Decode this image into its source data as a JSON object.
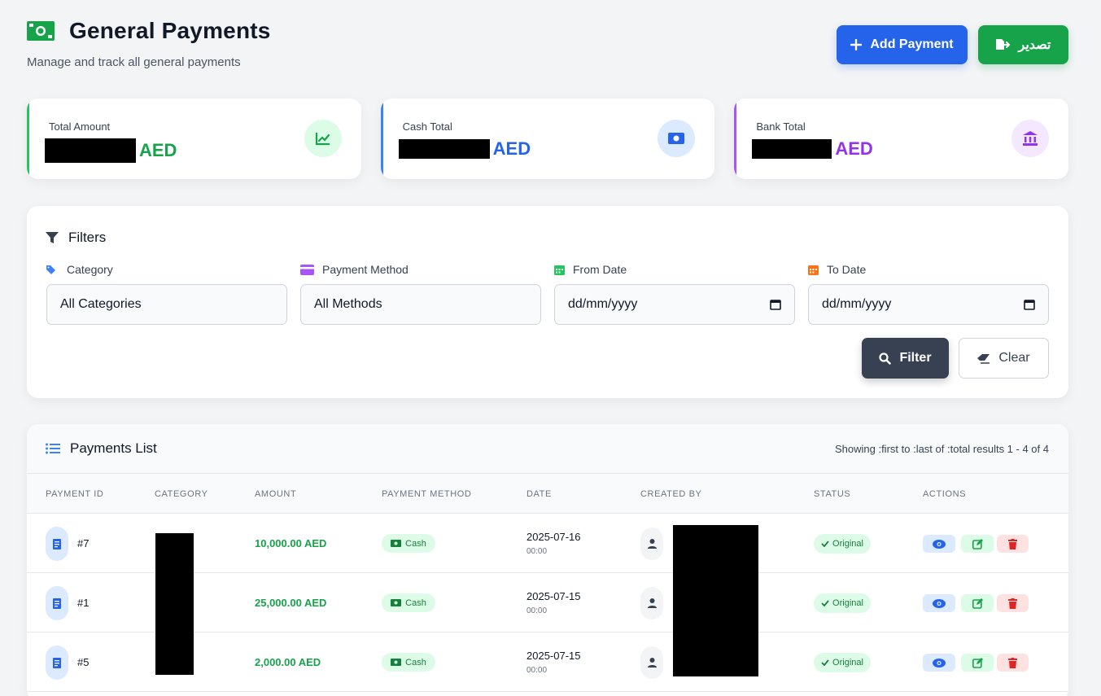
{
  "header": {
    "title": "General Payments",
    "subtitle": "Manage and track all general payments",
    "add_button": "Add Payment",
    "export_button": "تصدير"
  },
  "summary": {
    "total": {
      "label": "Total Amount",
      "currency": "AED"
    },
    "cash": {
      "label": "Cash Total",
      "currency": "AED"
    },
    "bank": {
      "label": "Bank Total",
      "currency": "AED"
    }
  },
  "filters": {
    "title": "Filters",
    "category": {
      "label": "Category",
      "value": "All Categories"
    },
    "method": {
      "label": "Payment Method",
      "value": "All Methods"
    },
    "from": {
      "label": "From Date",
      "value": "dd/mm/yyyy"
    },
    "to": {
      "label": "To Date",
      "value": "dd/mm/yyyy"
    },
    "filter_button": "Filter",
    "clear_button": "Clear"
  },
  "list": {
    "title": "Payments List",
    "count": "Showing :first to :last of :total results 1 - 4 of 4",
    "columns": [
      "PAYMENT ID",
      "CATEGORY",
      "AMOUNT",
      "PAYMENT METHOD",
      "DATE",
      "CREATED BY",
      "STATUS",
      "ACTIONS"
    ],
    "rows": [
      {
        "id": "#7",
        "amount": "10,000.00 AED",
        "method": "Cash",
        "date": "2025-07-16",
        "time": "00:00",
        "status": "Original"
      },
      {
        "id": "#1",
        "amount": "25,000.00 AED",
        "method": "Cash",
        "date": "2025-07-15",
        "time": "00:00",
        "status": "Original"
      },
      {
        "id": "#5",
        "amount": "2,000.00 AED",
        "method": "Cash",
        "date": "2025-07-15",
        "time": "00:00",
        "status": "Original"
      }
    ]
  },
  "colors": {
    "primary": "#2563eb",
    "success": "#16a34a",
    "purple": "#9333ea",
    "dark": "#374151"
  }
}
